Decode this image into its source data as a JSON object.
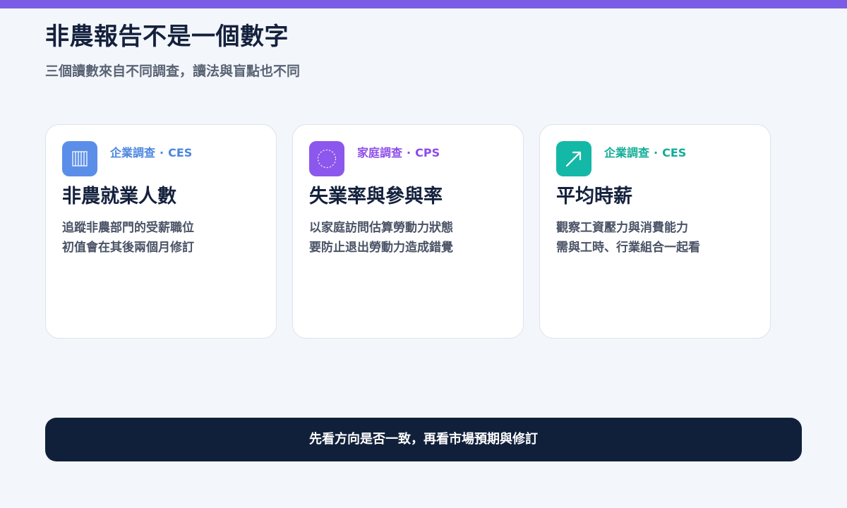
{
  "colors": {
    "accent": "#7b5ce6",
    "background": "#f3f6fb",
    "title": "#14213d",
    "subtitle": "#5b6475",
    "banner": "#11203a"
  },
  "header": {
    "title": "非農報告不是一個數字",
    "subtitle": "三個讀數來自不同調查，讀法與盲點也不同"
  },
  "cards": [
    {
      "icon": "bar-stack-icon",
      "icon_color": "#5b8ee8",
      "source_label": "企業調查",
      "separator": "·",
      "source_code": "CES",
      "source_color": "#4a86e0",
      "title": "非農就業人數",
      "lines": [
        "追蹤非農部門的受薪職位",
        "初值會在其後兩個月修訂"
      ]
    },
    {
      "icon": "dashed-circle-icon",
      "icon_color": "#8c57ec",
      "source_label": "家庭調查",
      "separator": "·",
      "source_code": "CPS",
      "source_color": "#8c4ce8",
      "title": "失業率與參與率",
      "lines": [
        "以家庭訪問估算勞動力狀態",
        "要防止退出勞動力造成錯覺"
      ]
    },
    {
      "icon": "arrow-up-right-icon",
      "icon_color": "#14b8a6",
      "source_label": "企業調查",
      "separator": "·",
      "source_code": "CES",
      "source_color": "#12ad98",
      "title": "平均時薪",
      "lines": [
        "觀察工資壓力與消費能力",
        "需與工時、行業組合一起看"
      ]
    }
  ],
  "footer": {
    "text": "先看方向是否一致，再看市場預期與修訂"
  }
}
